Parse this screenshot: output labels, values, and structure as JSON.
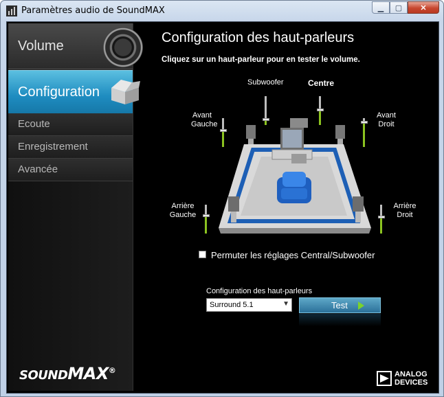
{
  "window": {
    "title": "Paramètres audio de SoundMAX"
  },
  "sidebar": {
    "items": [
      {
        "label": "Volume"
      },
      {
        "label": "Configuration"
      },
      {
        "label": "Ecoute"
      },
      {
        "label": "Enregistrement"
      },
      {
        "label": "Avancée"
      }
    ],
    "logo": {
      "part1": "SOUND",
      "part2": "MAX",
      "mark": "®"
    }
  },
  "main": {
    "heading": "Configuration des haut-parleurs",
    "subheading": "Cliquez sur un haut-parleur pour en tester le volume.",
    "speakers": {
      "subwoofer": "Subwoofer",
      "centre": "Centre",
      "front_left_1": "Avant",
      "front_left_2": "Gauche",
      "front_right_1": "Avant",
      "front_right_2": "Droit",
      "rear_left_1": "Arrière",
      "rear_left_2": "Gauche",
      "rear_right_1": "Arrière",
      "rear_right_2": "Droit"
    },
    "swap_checkbox_label": "Permuter les réglages Central/Subwoofer",
    "config_label": "Configuration des haut-parleurs",
    "config_value": "Surround 5.1",
    "test_button": "Test"
  },
  "brand": {
    "line1": "ANALOG",
    "line2": "DEVICES"
  },
  "icons": {
    "app": "soundmax-app-icon",
    "minimize": "minimize-icon",
    "maximize": "maximize-icon",
    "close": "close-icon",
    "dropdown": "chevron-down-icon",
    "play": "play-arrow-icon"
  },
  "colors": {
    "accent": "#1e8cc0",
    "slider_fill": "#8bc320",
    "room_border": "#1d5fb5"
  }
}
